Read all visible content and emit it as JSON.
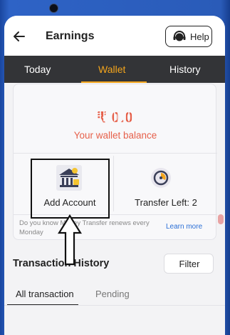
{
  "header": {
    "title": "Earnings",
    "help_label": "Help"
  },
  "tabs": [
    {
      "label": "Today",
      "active": false
    },
    {
      "label": "Wallet",
      "active": true
    },
    {
      "label": "History",
      "active": false
    }
  ],
  "wallet": {
    "balance_amount": "₹ 0.0",
    "balance_label": "Your wallet balance",
    "actions": [
      {
        "label": "Add Account",
        "icon": "bank-icon"
      },
      {
        "label": "Transfer Left: 2",
        "icon": "timer-icon"
      }
    ],
    "info_text": "Do you know Money Transfer renews every Monday",
    "learn_more": "Learn more"
  },
  "transactions": {
    "title": "Transaction History",
    "filter_label": "Filter",
    "subtabs": [
      {
        "label": "All transaction",
        "active": true
      },
      {
        "label": "Pending",
        "active": false
      }
    ]
  },
  "colors": {
    "accent": "#f4a51c",
    "balance": "#e6614b",
    "tabbar": "#333437",
    "link": "#2b6fd6"
  }
}
